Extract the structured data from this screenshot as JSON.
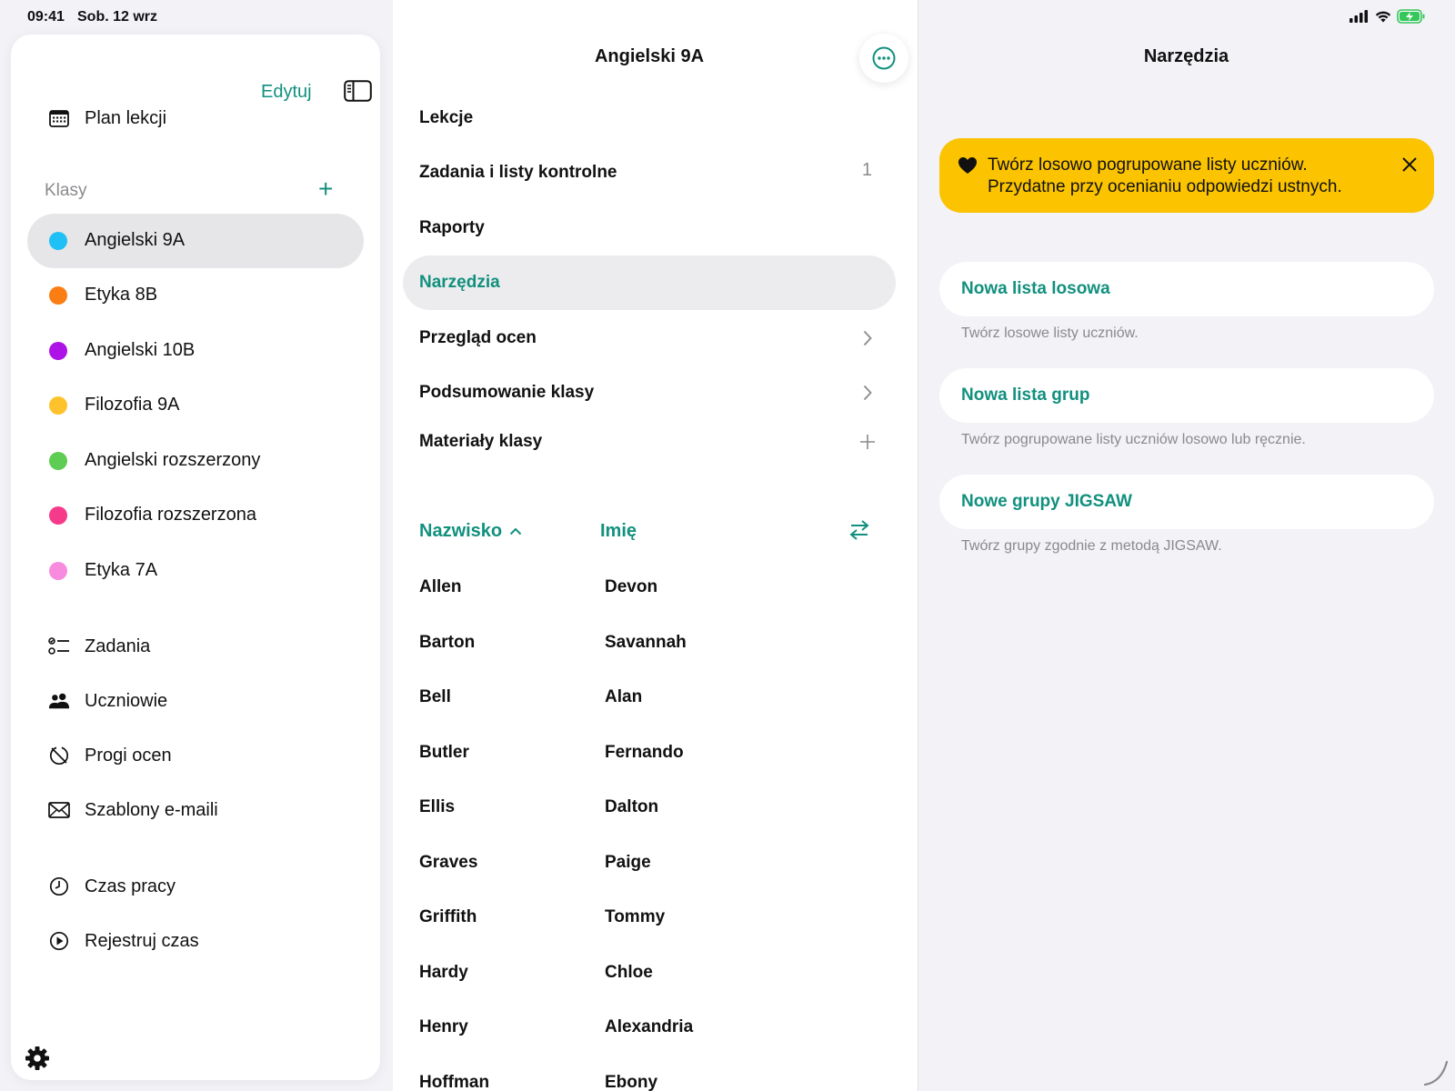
{
  "status_bar": {
    "time": "09:41",
    "date": "Sob. 12 wrz"
  },
  "sidebar": {
    "edit_label": "Edytuj",
    "schedule": {
      "label": "Plan lekcji",
      "icon": "calendar-icon"
    },
    "classes_section": {
      "label": "Klasy"
    },
    "classes": [
      {
        "label": "Angielski 9A",
        "color": "#1ec0f6",
        "selected": true
      },
      {
        "label": "Etyka 8B",
        "color": "#fb7e14"
      },
      {
        "label": "Angielski 10B",
        "color": "#ad12e6"
      },
      {
        "label": "Filozofia 9A",
        "color": "#fec32c"
      },
      {
        "label": "Angielski rozszerzony",
        "color": "#5fcd53"
      },
      {
        "label": "Filozofia rozszerzona",
        "color": "#f63a8b"
      },
      {
        "label": "Etyka 7A",
        "color": "#f78bdd"
      }
    ],
    "nav": [
      {
        "label": "Zadania",
        "icon": "tasks-icon"
      },
      {
        "label": "Uczniowie",
        "icon": "students-icon"
      },
      {
        "label": "Progi ocen",
        "icon": "grade-thresholds-icon"
      },
      {
        "label": "Szablony e-maili",
        "icon": "envelope-icon"
      }
    ],
    "time_nav": [
      {
        "label": "Czas pracy",
        "icon": "clock-icon"
      },
      {
        "label": "Rejestruj czas",
        "icon": "play-circle-icon"
      }
    ]
  },
  "middle": {
    "title": "Angielski 9A",
    "menu": [
      {
        "label": "Lekcje"
      },
      {
        "label": "Zadania i listy kontrolne",
        "count": "1"
      },
      {
        "label": "Raporty"
      },
      {
        "label": "Narzędzia",
        "selected": true
      },
      {
        "label": "Przegląd ocen"
      },
      {
        "label": "Podsumowanie klasy"
      },
      {
        "label": "Materiały klasy"
      }
    ],
    "sort": {
      "last_name_label": "Nazwisko",
      "first_name_label": "Imię"
    },
    "students": [
      {
        "last": "Allen",
        "first": "Devon"
      },
      {
        "last": "Barton",
        "first": "Savannah"
      },
      {
        "last": "Bell",
        "first": "Alan"
      },
      {
        "last": "Butler",
        "first": "Fernando"
      },
      {
        "last": "Ellis",
        "first": "Dalton"
      },
      {
        "last": "Graves",
        "first": "Paige"
      },
      {
        "last": "Griffith",
        "first": "Tommy"
      },
      {
        "last": "Hardy",
        "first": "Chloe"
      },
      {
        "last": "Henry",
        "first": "Alexandria"
      },
      {
        "last": "Hoffman",
        "first": "Ebony"
      }
    ]
  },
  "right": {
    "title": "Narzędzia",
    "banner": {
      "line1": "Twórz losowo pogrupowane listy uczniów.",
      "line2": "Przydatne przy ocenianiu odpowiedzi ustnych."
    },
    "tools": [
      {
        "label": "Nowa lista losowa",
        "description": "Twórz losowe listy uczniów."
      },
      {
        "label": "Nowa lista grup",
        "description": "Twórz pogrupowane listy uczniów losowo lub ręcznie."
      },
      {
        "label": "Nowe grupy JIGSAW",
        "description": "Twórz grupy zgodnie z metodą JIGSAW."
      }
    ]
  },
  "colors": {
    "accent": "#12907e",
    "banner": "#fbc300",
    "selection": "#e6e6e8"
  }
}
